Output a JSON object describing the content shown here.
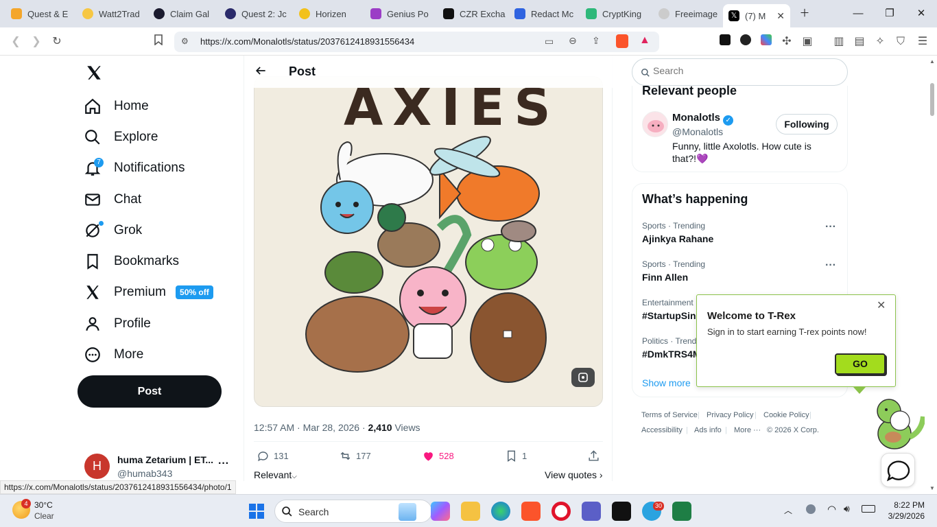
{
  "browser": {
    "tabs": [
      {
        "label": "Quest & E",
        "color": "#f4a62a"
      },
      {
        "label": "Watt2Trad",
        "color": "#f6c744"
      },
      {
        "label": "Claim Gal",
        "color": "#1a1a2e"
      },
      {
        "label": "Quest 2: Jc",
        "color": "#2a2a6a"
      },
      {
        "label": "Horizen",
        "color": "#f2c11b"
      },
      {
        "label": "Genius Po",
        "color": "#9b3dc6"
      },
      {
        "label": "CZR Excha",
        "color": "#111111"
      },
      {
        "label": "Redact Mc",
        "color": "#2f63e0"
      },
      {
        "label": "CryptKing",
        "color": "#2eb87a"
      },
      {
        "label": "Freeimage",
        "color": "#cccccc"
      },
      {
        "label": "(7) M",
        "color": "#000000"
      }
    ],
    "url": "https://x.com/Monalotls/status/2037612418931556434",
    "status_url": "https://x.com/Monalotls/status/2037612418931556434/photo/1"
  },
  "nav": {
    "items": [
      {
        "label": "Home",
        "icon": "home-icon"
      },
      {
        "label": "Explore",
        "icon": "search-icon"
      },
      {
        "label": "Notifications",
        "icon": "bell-icon",
        "badge": "7"
      },
      {
        "label": "Chat",
        "icon": "mail-icon"
      },
      {
        "label": "Grok",
        "icon": "grok-icon"
      },
      {
        "label": "Bookmarks",
        "icon": "bookmark-icon"
      },
      {
        "label": "Premium",
        "icon": "x-icon",
        "badge": "50% off"
      },
      {
        "label": "Profile",
        "icon": "person-icon"
      },
      {
        "label": "More",
        "icon": "more-circle-icon"
      }
    ],
    "post_button": "Post",
    "account": {
      "name": "huma Zetarium | ET...",
      "handle": "@humab343",
      "initial": "H"
    }
  },
  "post": {
    "header": "Post",
    "image_title": "AXIES",
    "timestamp": "12:57 AM · Mar 28, 2026 ·",
    "views_count": "2,410",
    "views_label": "Views",
    "replies": "131",
    "reposts": "177",
    "likes": "528",
    "bookmarks": "1",
    "sort_label": "Relevant",
    "view_quotes": "View quotes"
  },
  "right": {
    "search_placeholder": "Search",
    "relevant_people_title": "Relevant people",
    "person": {
      "name": "Monalotls",
      "handle": "@Monalotls",
      "button": "Following",
      "bio": "Funny, little Axolotls. How cute is that?!💜"
    },
    "happening_title": "What’s happening",
    "trends": [
      {
        "category": "Sports · Trending",
        "name": "Ajinkya Rahane"
      },
      {
        "category": "Sports · Trending",
        "name": "Finn Allen"
      },
      {
        "category": "Entertainment",
        "name": "#StartupSin"
      },
      {
        "category": "Politics · Trend",
        "name": "#DmkTRS4M"
      }
    ],
    "show_more": "Show more",
    "footer": [
      "Terms of Service",
      "Privacy Policy",
      "Cookie Policy",
      "Accessibility",
      "Ads info",
      "More ···",
      "© 2026 X Corp."
    ]
  },
  "trex": {
    "title": "Welcome to T-Rex",
    "message": "Sign in to start earning T-rex points now!",
    "button": "GO"
  },
  "taskbar": {
    "weather_temp": "30°C",
    "weather_desc": "Clear",
    "weather_badge": "4",
    "search_label": "Search",
    "time": "8:22 PM",
    "date": "3/29/2026",
    "telegram_badge": "30"
  },
  "colors": {
    "x_blue": "#1d9bf0",
    "like_pink": "#f91880",
    "trex_green": "#a3dc1d"
  }
}
